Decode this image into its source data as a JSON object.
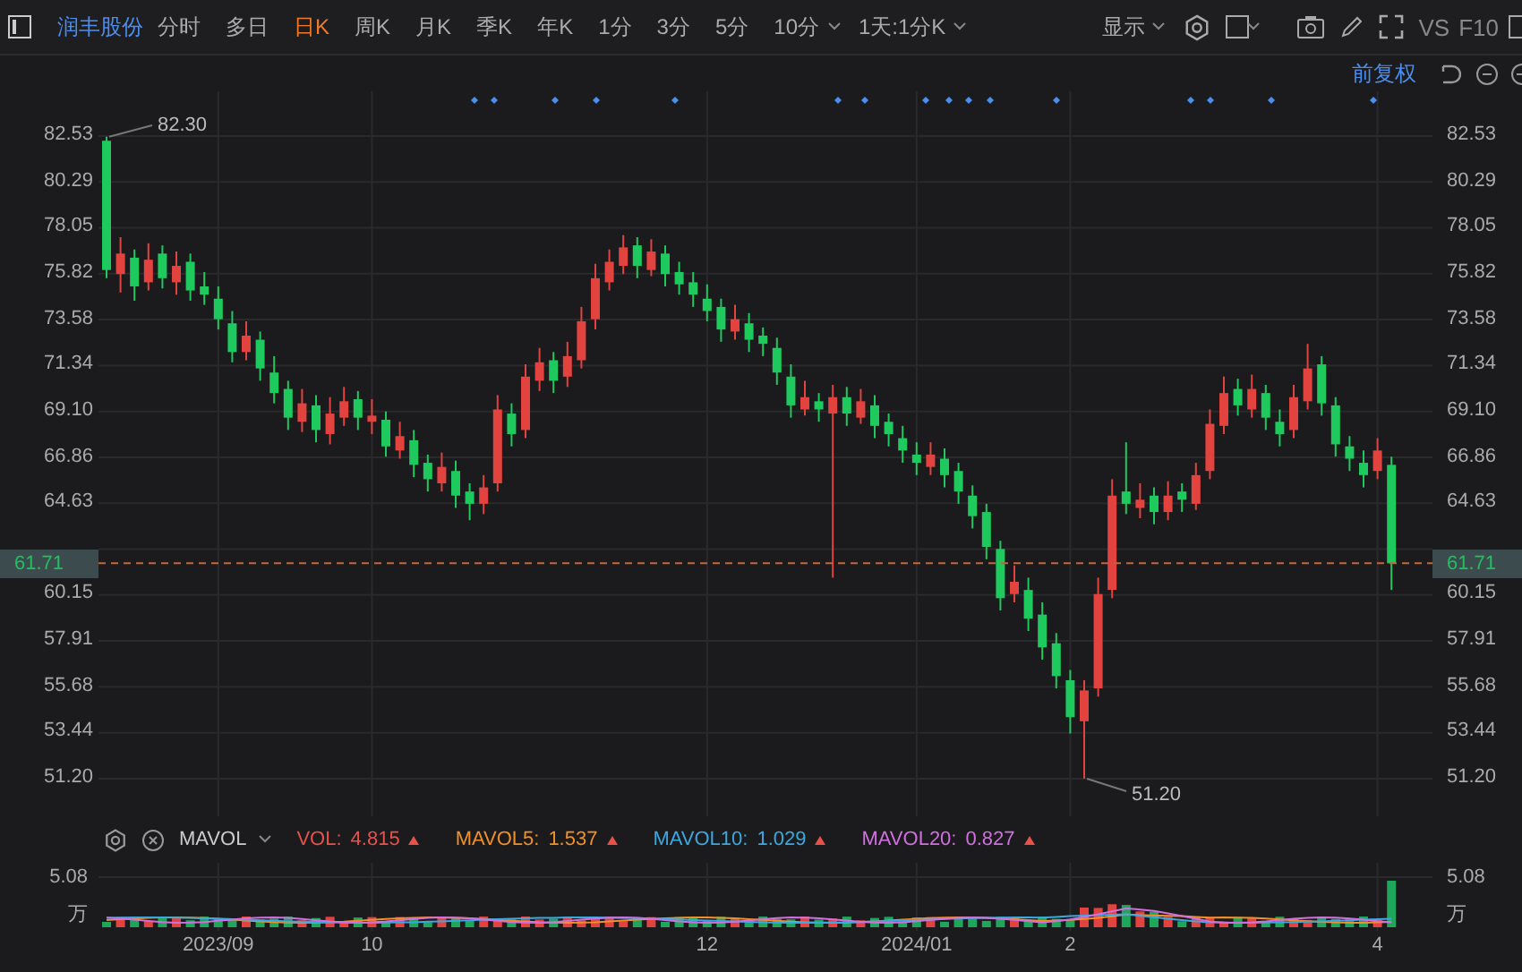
{
  "toolbar": {
    "stock_name": "润丰股份",
    "periods": [
      {
        "label": "分时",
        "selected": false,
        "dropdown": false
      },
      {
        "label": "多日",
        "selected": false,
        "dropdown": false
      },
      {
        "label": "日K",
        "selected": true,
        "dropdown": false
      },
      {
        "label": "周K",
        "selected": false,
        "dropdown": false
      },
      {
        "label": "月K",
        "selected": false,
        "dropdown": false
      },
      {
        "label": "季K",
        "selected": false,
        "dropdown": false
      },
      {
        "label": "年K",
        "selected": false,
        "dropdown": false
      },
      {
        "label": "1分",
        "selected": false,
        "dropdown": false
      },
      {
        "label": "3分",
        "selected": false,
        "dropdown": false
      },
      {
        "label": "5分",
        "selected": false,
        "dropdown": false
      },
      {
        "label": "10分",
        "selected": false,
        "dropdown": true
      }
    ],
    "range_select": "1天:1分K",
    "display_menu": "显示",
    "text_buttons": [
      "VS",
      "F10"
    ]
  },
  "adjust_mode": "前复权",
  "left_axis": {
    "current_price": "61.71"
  },
  "right_axis": {
    "ticks": [
      "82.53",
      "80.29",
      "78.05",
      "75.82",
      "73.58",
      "71.34",
      "69.10",
      "66.86",
      "64.63",
      "60.15",
      "57.91",
      "55.68",
      "53.44",
      "51.20"
    ],
    "current_price": "61.71"
  },
  "chart": {
    "high_label": "82.30",
    "low_label": "51.20",
    "chart_data": {
      "type": "candlestick",
      "ylim": [
        51.2,
        82.53
      ],
      "grid": true,
      "ref_lines": [
        {
          "axis": "y",
          "value": 61.71
        }
      ],
      "yticks": [
        {
          "value": 82.53,
          "label": "82.53"
        },
        {
          "value": 80.29,
          "label": "80.29"
        },
        {
          "value": 78.05,
          "label": "78.05"
        },
        {
          "value": 75.82,
          "label": "75.82"
        },
        {
          "value": 73.58,
          "label": "73.58"
        },
        {
          "value": 71.34,
          "label": "71.34"
        },
        {
          "value": 69.1,
          "label": "69.10"
        },
        {
          "value": 66.86,
          "label": "66.86"
        },
        {
          "value": 64.63,
          "label": "64.63"
        },
        {
          "value": 60.15,
          "label": "60.15"
        },
        {
          "value": 57.91,
          "label": "57.91"
        },
        {
          "value": 55.68,
          "label": "55.68"
        },
        {
          "value": 53.44,
          "label": "53.44"
        },
        {
          "value": 51.2,
          "label": "51.20"
        }
      ],
      "categories": [
        null,
        null,
        null,
        null,
        null,
        null,
        null,
        null,
        "2023/09",
        null,
        null,
        null,
        null,
        null,
        null,
        null,
        null,
        null,
        null,
        "10",
        null,
        null,
        null,
        null,
        null,
        null,
        null,
        null,
        null,
        null,
        null,
        null,
        null,
        null,
        null,
        null,
        null,
        null,
        null,
        null,
        null,
        null,
        null,
        "12",
        null,
        null,
        null,
        null,
        null,
        null,
        null,
        null,
        null,
        null,
        null,
        null,
        null,
        null,
        "2024/01",
        null,
        null,
        null,
        null,
        null,
        null,
        null,
        null,
        null,
        null,
        "2",
        null,
        null,
        null,
        null,
        null,
        null,
        null,
        null,
        null,
        null,
        null,
        null,
        null,
        null,
        null,
        null,
        null,
        null,
        null,
        null,
        null,
        "4",
        null
      ],
      "ohlc": [
        [
          82.3,
          82.5,
          75.6,
          76.0
        ],
        [
          75.8,
          77.6,
          74.9,
          76.8
        ],
        [
          76.6,
          77.0,
          74.5,
          75.2
        ],
        [
          75.4,
          77.3,
          75.0,
          76.5
        ],
        [
          76.8,
          77.2,
          75.1,
          75.6
        ],
        [
          75.4,
          76.9,
          74.8,
          76.2
        ],
        [
          76.4,
          76.8,
          74.5,
          75.0
        ],
        [
          75.2,
          75.9,
          74.3,
          74.8
        ],
        [
          74.6,
          75.2,
          73.1,
          73.6
        ],
        [
          73.4,
          74.0,
          71.5,
          72.0
        ],
        [
          72.0,
          73.5,
          71.6,
          72.8
        ],
        [
          72.6,
          73.0,
          70.6,
          71.2
        ],
        [
          71.0,
          71.8,
          69.5,
          70.0
        ],
        [
          70.2,
          70.6,
          68.2,
          68.8
        ],
        [
          68.6,
          70.2,
          68.1,
          69.5
        ],
        [
          69.4,
          69.9,
          67.6,
          68.2
        ],
        [
          68.0,
          69.8,
          67.5,
          69.0
        ],
        [
          68.8,
          70.3,
          68.4,
          69.6
        ],
        [
          69.7,
          70.1,
          68.2,
          68.8
        ],
        [
          68.6,
          69.7,
          68.0,
          68.9
        ],
        [
          68.7,
          69.1,
          66.9,
          67.4
        ],
        [
          67.2,
          68.6,
          66.8,
          67.9
        ],
        [
          67.7,
          68.2,
          65.9,
          66.5
        ],
        [
          66.6,
          67.0,
          65.2,
          65.8
        ],
        [
          65.6,
          67.1,
          65.2,
          66.4
        ],
        [
          66.2,
          66.7,
          64.4,
          65.0
        ],
        [
          65.2,
          65.6,
          63.8,
          64.6
        ],
        [
          64.6,
          66.0,
          64.1,
          65.4
        ],
        [
          65.6,
          69.9,
          65.2,
          69.2
        ],
        [
          69.0,
          69.5,
          67.4,
          68.0
        ],
        [
          68.2,
          71.4,
          67.8,
          70.8
        ],
        [
          70.6,
          72.2,
          70.1,
          71.5
        ],
        [
          71.6,
          72.0,
          70.0,
          70.6
        ],
        [
          70.8,
          72.5,
          70.3,
          71.8
        ],
        [
          71.6,
          74.2,
          71.2,
          73.5
        ],
        [
          73.6,
          76.3,
          73.1,
          75.6
        ],
        [
          75.4,
          77.0,
          75.0,
          76.4
        ],
        [
          76.2,
          77.7,
          75.8,
          77.1
        ],
        [
          77.2,
          77.6,
          75.6,
          76.2
        ],
        [
          76.0,
          77.5,
          75.7,
          76.9
        ],
        [
          76.8,
          77.2,
          75.2,
          75.8
        ],
        [
          75.9,
          76.4,
          74.8,
          75.3
        ],
        [
          75.4,
          75.9,
          74.2,
          74.8
        ],
        [
          74.6,
          75.3,
          73.5,
          74.0
        ],
        [
          74.2,
          74.6,
          72.5,
          73.1
        ],
        [
          73.0,
          74.3,
          72.6,
          73.6
        ],
        [
          73.4,
          73.9,
          72.0,
          72.6
        ],
        [
          72.8,
          73.2,
          71.8,
          72.4
        ],
        [
          72.2,
          72.7,
          70.4,
          71.0
        ],
        [
          70.8,
          71.4,
          68.8,
          69.4
        ],
        [
          69.2,
          70.6,
          68.9,
          69.8
        ],
        [
          69.6,
          70.0,
          68.6,
          69.2
        ],
        [
          69.0,
          70.4,
          61.0,
          69.8
        ],
        [
          69.8,
          70.3,
          68.4,
          69.0
        ],
        [
          68.8,
          70.2,
          68.5,
          69.6
        ],
        [
          69.4,
          69.9,
          67.8,
          68.4
        ],
        [
          68.6,
          69.0,
          67.4,
          68.0
        ],
        [
          67.8,
          68.4,
          66.6,
          67.2
        ],
        [
          67.0,
          67.6,
          66.0,
          66.6
        ],
        [
          66.4,
          67.6,
          66.0,
          67.0
        ],
        [
          66.8,
          67.3,
          65.4,
          66.0
        ],
        [
          66.2,
          66.6,
          64.6,
          65.2
        ],
        [
          65.0,
          65.5,
          63.4,
          64.0
        ],
        [
          64.2,
          64.6,
          61.9,
          62.5
        ],
        [
          62.4,
          62.8,
          59.4,
          60.0
        ],
        [
          60.2,
          61.6,
          59.8,
          60.8
        ],
        [
          60.4,
          61.0,
          58.4,
          59.0
        ],
        [
          59.2,
          59.8,
          57.0,
          57.6
        ],
        [
          57.8,
          58.3,
          55.6,
          56.2
        ],
        [
          56.0,
          56.5,
          53.4,
          54.2
        ],
        [
          54.0,
          56.0,
          51.2,
          55.5
        ],
        [
          55.6,
          61.0,
          55.2,
          60.2
        ],
        [
          60.4,
          65.8,
          60.0,
          65.0
        ],
        [
          65.2,
          67.6,
          64.1,
          64.6
        ],
        [
          64.4,
          65.6,
          63.9,
          64.8
        ],
        [
          65.0,
          65.4,
          63.6,
          64.2
        ],
        [
          64.2,
          65.7,
          63.8,
          65.0
        ],
        [
          65.2,
          65.6,
          64.2,
          64.8
        ],
        [
          64.6,
          66.6,
          64.3,
          66.0
        ],
        [
          66.2,
          69.2,
          65.8,
          68.5
        ],
        [
          68.4,
          70.8,
          68.0,
          70.0
        ],
        [
          70.2,
          70.7,
          68.9,
          69.4
        ],
        [
          69.2,
          70.9,
          68.8,
          70.2
        ],
        [
          70.0,
          70.4,
          68.2,
          68.8
        ],
        [
          68.6,
          69.2,
          67.4,
          68.0
        ],
        [
          68.2,
          70.4,
          67.8,
          69.8
        ],
        [
          69.6,
          72.4,
          69.2,
          71.2
        ],
        [
          71.4,
          71.8,
          68.9,
          69.5
        ],
        [
          69.4,
          69.8,
          66.9,
          67.5
        ],
        [
          67.4,
          67.9,
          66.2,
          66.8
        ],
        [
          66.6,
          67.2,
          65.4,
          66.0
        ],
        [
          66.2,
          67.8,
          65.8,
          67.2
        ],
        [
          66.5,
          66.9,
          60.4,
          61.7
        ]
      ]
    }
  },
  "indicator": {
    "name": "MAVOL",
    "items": [
      {
        "label": "VOL:",
        "value": "4.815",
        "color": "#e8524a"
      },
      {
        "label": "MAVOL5:",
        "value": "1.537",
        "color": "#f0902a"
      },
      {
        "label": "MAVOL10:",
        "value": "1.029",
        "color": "#3ba8e0"
      },
      {
        "label": "MAVOL20:",
        "value": "0.827",
        "color": "#d070e0"
      }
    ]
  },
  "volume_left_axis": {
    "max": "5.08",
    "unit": "万"
  },
  "volume_right_axis": {
    "max": "5.08",
    "unit": "万"
  }
}
